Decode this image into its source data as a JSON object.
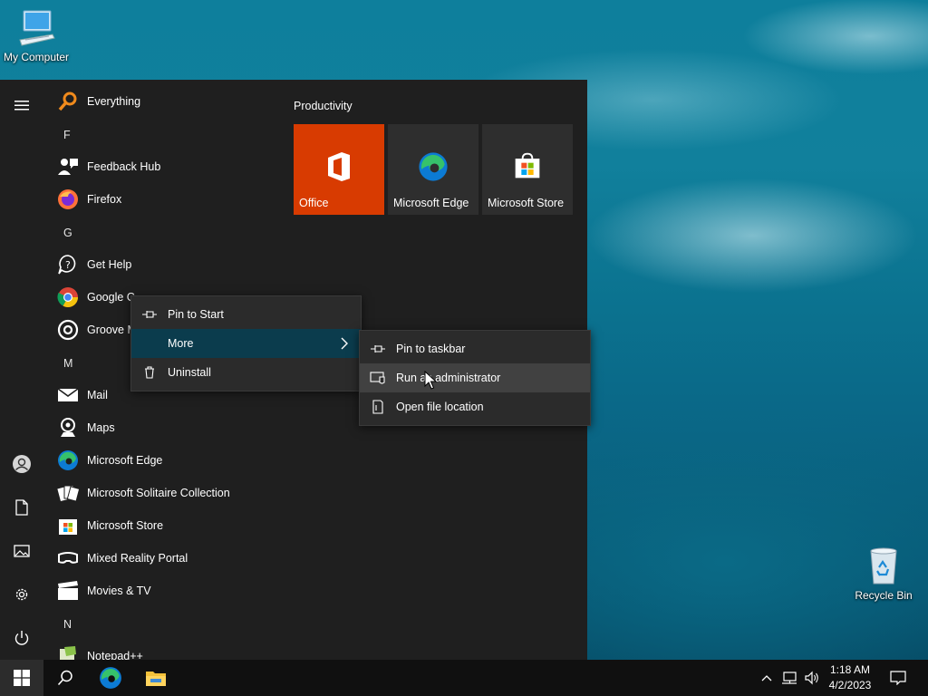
{
  "desktop": {
    "icons": [
      {
        "label": "My Computer",
        "icon": "computer-icon"
      },
      {
        "label": "Recycle Bin",
        "icon": "recycle-bin-icon"
      }
    ]
  },
  "start_menu": {
    "rail": [
      "hamburger-menu-icon",
      "user-icon",
      "documents-icon",
      "pictures-icon",
      "settings-icon",
      "power-icon"
    ],
    "apps": [
      {
        "type": "app",
        "label": "Everything",
        "icon": "search-magnifier-icon"
      },
      {
        "type": "letter",
        "label": "F"
      },
      {
        "type": "app",
        "label": "Feedback Hub",
        "icon": "feedback-hub-icon"
      },
      {
        "type": "app",
        "label": "Firefox",
        "icon": "firefox-icon"
      },
      {
        "type": "letter",
        "label": "G"
      },
      {
        "type": "app",
        "label": "Get Help",
        "icon": "get-help-icon"
      },
      {
        "type": "app",
        "label": "Google Chrome",
        "visible_label": "Google C",
        "icon": "chrome-icon"
      },
      {
        "type": "app",
        "label": "Groove Music",
        "visible_label": "Groove M",
        "icon": "groove-music-icon"
      },
      {
        "type": "letter",
        "label": "M"
      },
      {
        "type": "app",
        "label": "Mail",
        "icon": "mail-icon"
      },
      {
        "type": "app",
        "label": "Maps",
        "icon": "maps-icon"
      },
      {
        "type": "app",
        "label": "Microsoft Edge",
        "icon": "edge-icon"
      },
      {
        "type": "app",
        "label": "Microsoft Solitaire Collection",
        "icon": "solitaire-icon"
      },
      {
        "type": "app",
        "label": "Microsoft Store",
        "icon": "store-icon"
      },
      {
        "type": "app",
        "label": "Mixed Reality Portal",
        "icon": "mixed-reality-icon"
      },
      {
        "type": "app",
        "label": "Movies & TV",
        "icon": "movies-tv-icon"
      },
      {
        "type": "letter",
        "label": "N"
      },
      {
        "type": "app",
        "label": "Notepad++",
        "icon": "notepadpp-icon"
      }
    ],
    "tiles": {
      "group_title": "Productivity",
      "items": [
        {
          "label": "Office",
          "icon": "office-icon",
          "color": "#d83b01"
        },
        {
          "label": "Microsoft Edge",
          "icon": "edge-icon",
          "color": "#2e2e2e"
        },
        {
          "label": "Microsoft Store",
          "icon": "store-icon",
          "color": "#2e2e2e"
        }
      ]
    }
  },
  "context_menu": {
    "items": [
      {
        "label": "Pin to Start",
        "icon": "pin-icon"
      },
      {
        "label": "More",
        "icon": "",
        "submenu": true
      },
      {
        "label": "Uninstall",
        "icon": "trash-icon"
      }
    ]
  },
  "submenu": {
    "items": [
      {
        "label": "Pin to taskbar",
        "icon": "pin-icon"
      },
      {
        "label": "Run as administrator",
        "icon": "run-admin-icon"
      },
      {
        "label": "Open file location",
        "icon": "folder-location-icon"
      }
    ]
  },
  "taskbar": {
    "buttons": [
      "windows-start-icon",
      "search-icon",
      "edge-icon",
      "file-explorer-icon"
    ],
    "tray": [
      "chevron-up-icon",
      "network-icon",
      "volume-icon"
    ],
    "time": "1:18 AM",
    "date": "4/2/2023",
    "notification_icon": "action-center-icon"
  },
  "colors": {
    "start_bg": "#1f1f1f",
    "menu_bg": "#2b2b2b",
    "selected": "#0b3c4d",
    "office": "#d83b01",
    "taskbar": "#101010"
  }
}
